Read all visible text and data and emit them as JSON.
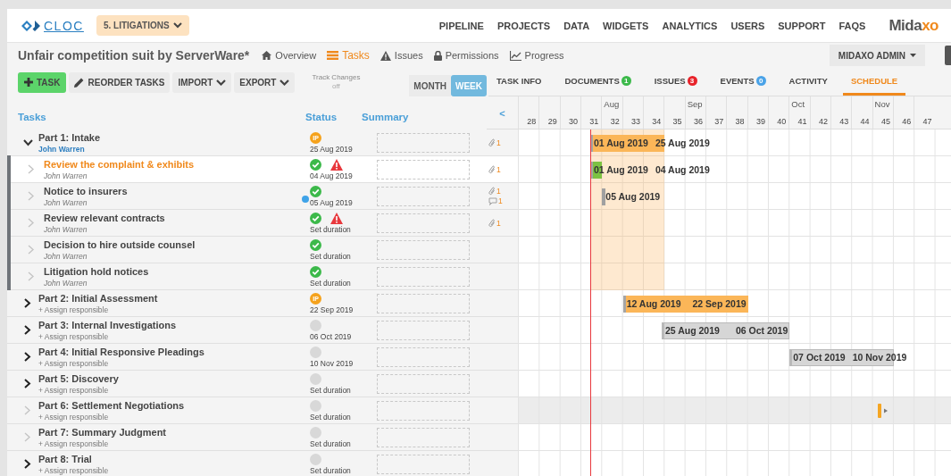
{
  "topbar": {
    "logo": "CLOC",
    "project": "5. LITIGATIONS",
    "nav": [
      "PIPELINE",
      "PROJECTS",
      "DATA",
      "WIDGETS",
      "ANALYTICS",
      "USERS",
      "SUPPORT",
      "FAQS"
    ],
    "brand": {
      "main": "Mida",
      "accent": "xo"
    }
  },
  "title": "Unfair competition suit by ServerWare*",
  "title_tabs": [
    {
      "label": "Overview",
      "selected": false
    },
    {
      "label": "Tasks",
      "selected": true
    },
    {
      "label": "Issues",
      "selected": false
    },
    {
      "label": "Permissions",
      "selected": false
    },
    {
      "label": "Progress",
      "selected": false
    }
  ],
  "user_menu": "MIDAXO ADMIN",
  "toolbar": [
    {
      "label": "TASK",
      "kind": "primary"
    },
    {
      "label": "REORDER TASKS",
      "kind": "default"
    },
    {
      "label": "IMPORT",
      "kind": "default"
    },
    {
      "label": "EXPORT",
      "kind": "default"
    }
  ],
  "track_changes": {
    "label": "Track Changes",
    "value": "off"
  },
  "view_toggle": [
    {
      "label": "MONTH",
      "selected": false
    },
    {
      "label": "WEEK",
      "selected": true
    }
  ],
  "columns": [
    "Tasks",
    "Status",
    "Summary"
  ],
  "detail_tabs": [
    {
      "label": "TASK INFO",
      "selected": false
    },
    {
      "label": "DOCUMENTS",
      "badge": "1",
      "color": "#3cb94a",
      "selected": false
    },
    {
      "label": "ISSUES",
      "badge": "3",
      "color": "#e8232a",
      "selected": false
    },
    {
      "label": "EVENTS",
      "badge": "0",
      "color": "#4aa3e8",
      "selected": false
    },
    {
      "label": "ACTIVITY",
      "selected": false
    },
    {
      "label": "SCHEDULE",
      "selected": true
    }
  ],
  "timeline": {
    "back": "<",
    "weeks": [
      {
        "week": "28"
      },
      {
        "week": "29"
      },
      {
        "week": "30"
      },
      {
        "week": "31"
      },
      {
        "week": "32",
        "month": "Aug"
      },
      {
        "week": "33"
      },
      {
        "week": "34"
      },
      {
        "week": "35"
      },
      {
        "week": "36",
        "month": "Sep"
      },
      {
        "week": "37"
      },
      {
        "week": "38"
      },
      {
        "week": "39"
      },
      {
        "week": "40"
      },
      {
        "week": "41",
        "month": "Oct"
      },
      {
        "week": "42"
      },
      {
        "week": "43"
      },
      {
        "week": "44"
      },
      {
        "week": "45",
        "month": "Nov"
      },
      {
        "week": "46"
      },
      {
        "week": "47"
      }
    ]
  },
  "tasks": [
    {
      "name": "Part 1: Intake",
      "owner": "John Warren",
      "assigned": true,
      "expandable": true,
      "expanded": true,
      "selected": false,
      "hovered": false,
      "status": {
        "kind": "in_progress",
        "badge": "IP",
        "date": "25 Aug 2019"
      },
      "warning": false,
      "unread": false,
      "attachments": "1",
      "bar": {
        "kind": "summary",
        "start": "01 Aug 2019",
        "end": "25 Aug 2019"
      },
      "children": [
        {
          "name": "Review the complaint & exhibits",
          "owner": "John Warren",
          "expandable": false,
          "selected": true,
          "hovered": false,
          "status": {
            "kind": "done",
            "date": "04 Aug 2019"
          },
          "warning": true,
          "unread": false,
          "attachments": "1",
          "bar": {
            "kind": "task",
            "start": "01 Aug 2019",
            "end": "04 Aug 2019"
          }
        },
        {
          "name": "Notice to insurers",
          "owner": "John Warren",
          "expandable": false,
          "selected": false,
          "hovered": false,
          "status": {
            "kind": "done",
            "date": "05 Aug 2019"
          },
          "warning": false,
          "unread": true,
          "attachments": "1",
          "comments": "1",
          "bar": {
            "kind": "milestone",
            "start": "05 Aug 2019"
          }
        },
        {
          "name": "Review relevant contracts",
          "owner": "John Warren",
          "expandable": false,
          "selected": false,
          "hovered": false,
          "status": {
            "kind": "done",
            "date": "Set duration"
          },
          "warning": true,
          "unread": false,
          "attachments": "1"
        },
        {
          "name": "Decision to hire outside counsel",
          "owner": "John Warren",
          "expandable": false,
          "selected": false,
          "hovered": false,
          "status": {
            "kind": "done",
            "date": "Set duration"
          },
          "warning": false,
          "unread": false
        },
        {
          "name": "Litigation hold notices",
          "owner": "John Warren",
          "expandable": false,
          "selected": false,
          "hovered": false,
          "status": {
            "kind": "done",
            "date": "Set duration"
          },
          "warning": false,
          "unread": false
        }
      ]
    },
    {
      "name": "Part 2: Initial Assessment",
      "owner": "+ Assign responsible",
      "assigned": false,
      "expandable": true,
      "expanded": false,
      "selected": false,
      "hovered": false,
      "status": {
        "kind": "in_progress",
        "badge": "IP",
        "date": "22 Sep 2019"
      },
      "warning": false,
      "unread": false,
      "bar": {
        "kind": "summary",
        "start": "12 Aug 2019",
        "end": "22 Sep 2019"
      }
    },
    {
      "name": "Part 3: Internal Investigations",
      "owner": "+ Assign responsible",
      "assigned": false,
      "expandable": true,
      "expanded": false,
      "selected": false,
      "hovered": false,
      "status": {
        "kind": "not_started",
        "date": "06 Oct 2019"
      },
      "warning": false,
      "unread": false,
      "bar": {
        "kind": "summary",
        "start": "25 Aug 2019",
        "end": "06 Oct 2019"
      }
    },
    {
      "name": "Part 4: Initial Responsive Pleadings",
      "owner": "+ Assign responsible",
      "assigned": false,
      "expandable": true,
      "expanded": false,
      "selected": false,
      "hovered": false,
      "status": {
        "kind": "not_started",
        "date": "10 Nov 2019"
      },
      "warning": false,
      "unread": false,
      "bar": {
        "kind": "summary",
        "start": "07 Oct 2019",
        "end": "10 Nov 2019"
      }
    },
    {
      "name": "Part 5: Discovery",
      "owner": "+ Assign responsible",
      "assigned": false,
      "expandable": true,
      "expanded": false,
      "selected": false,
      "hovered": false,
      "status": {
        "kind": "not_started",
        "date": "Set duration"
      },
      "warning": false,
      "unread": false
    },
    {
      "name": "Part 6: Settlement Negotiations",
      "owner": "+ Assign responsible",
      "assigned": false,
      "expandable": false,
      "selected": false,
      "hovered": true,
      "status": {
        "kind": "not_started",
        "date": "Set duration"
      },
      "warning": false,
      "unread": false,
      "bar": {
        "kind": "pointer"
      }
    },
    {
      "name": "Part 7: Summary Judgment",
      "owner": "+ Assign responsible",
      "assigned": false,
      "expandable": false,
      "selected": false,
      "hovered": false,
      "status": {
        "kind": "not_started",
        "date": "Set duration"
      },
      "warning": false,
      "unread": false
    },
    {
      "name": "Part 8: Trial",
      "owner": "+ Assign responsible",
      "assigned": false,
      "expandable": true,
      "expanded": false,
      "selected": false,
      "hovered": false,
      "status": {
        "kind": "not_started",
        "date": "Set duration"
      },
      "warning": false,
      "unread": false
    }
  ]
}
